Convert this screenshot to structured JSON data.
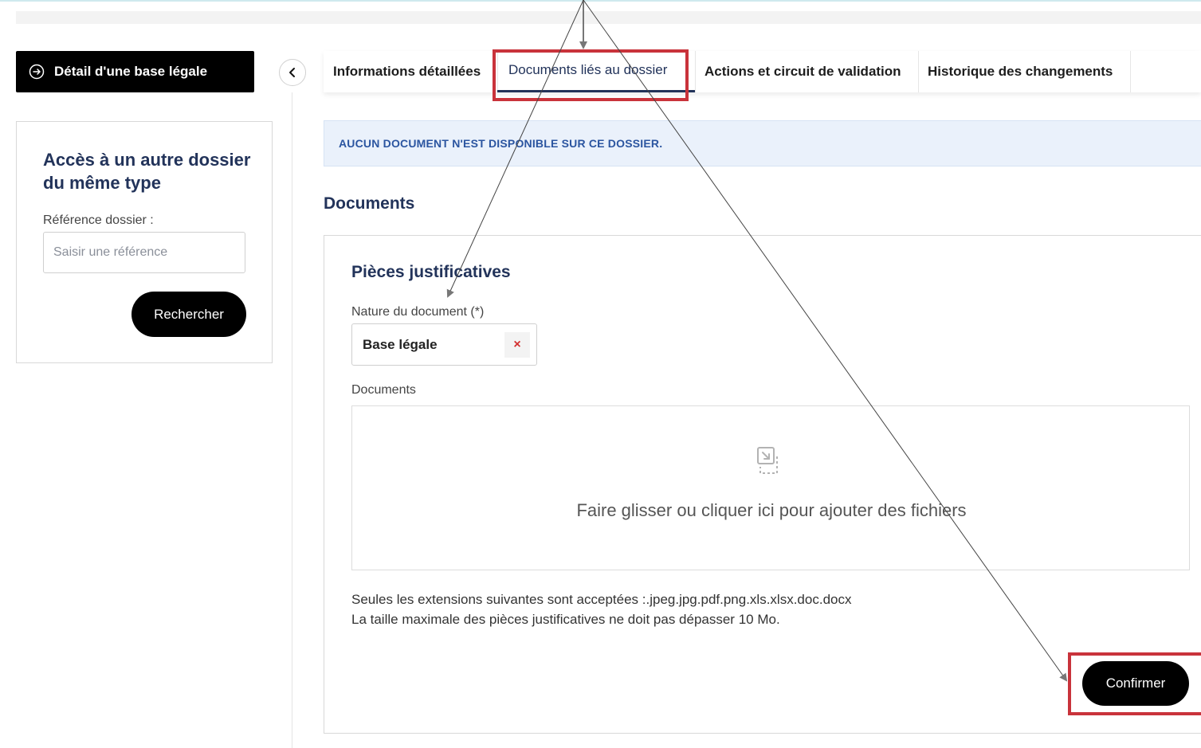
{
  "left_panel": {
    "detail_button_label": "Détail d'une base légale",
    "card_title": "Accès à un autre dossier du même type",
    "reference_label": "Référence dossier :",
    "reference_placeholder": "Saisir une référence",
    "search_button_label": "Rechercher"
  },
  "tabs": [
    {
      "label": "Informations détaillées",
      "active": false
    },
    {
      "label": "Documents liés au dossier",
      "active": true
    },
    {
      "label": "Actions et circuit de validation",
      "active": false
    },
    {
      "label": "Historique des changements",
      "active": false
    }
  ],
  "info_banner": "AUCUN DOCUMENT N'EST DISPONIBLE SUR CE DOSSIER.",
  "documents_section": {
    "title": "Documents",
    "pieces_title": "Pièces justificatives",
    "nature_label": "Nature du document (*)",
    "nature_value": "Base légale",
    "clear_symbol": "×",
    "documents_label": "Documents",
    "dropzone_text": "Faire glisser ou cliquer ici pour ajouter des fichiers",
    "extensions_text": "Seules les extensions suivantes sont acceptées :.jpeg.jpg.pdf.png.xls.xlsx.doc.docx",
    "size_text": "La taille maximale des pièces justificatives ne doit pas dépasser 10 Mo.",
    "confirm_button_label": "Confirmer"
  },
  "colors": {
    "highlight": "#c9333b",
    "navy": "#22335a",
    "banner_bg": "#eaf1fb",
    "banner_text": "#2b55a0"
  },
  "icons": {
    "detail": "circle-arrow-right-icon",
    "collapse": "chevron-left-icon",
    "dropzone": "file-upload-icon",
    "clear": "close-icon"
  }
}
